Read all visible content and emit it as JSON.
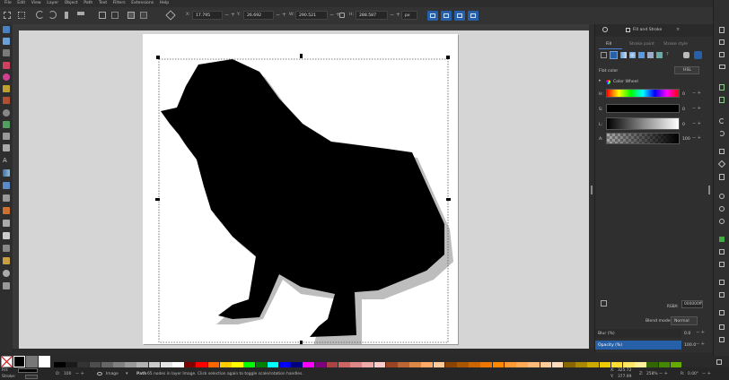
{
  "menu": [
    "File",
    "Edit",
    "View",
    "Layer",
    "Object",
    "Path",
    "Text",
    "Filters",
    "Extensions",
    "Help"
  ],
  "toolbar": {
    "x_label": "X:",
    "x_value": "17.795",
    "y_label": "Y:",
    "y_value": "26.692",
    "w_label": "W:",
    "w_value": "290.521",
    "h_label": "H:",
    "h_value": "288.587",
    "unit": "px"
  },
  "dock": {
    "tab_title": "Fill and Stroke",
    "tabs": [
      "Fill",
      "Stroke paint",
      "Stroke style"
    ],
    "fill_mode": "Flat color",
    "color_model": "HSL",
    "color_wheel_label": "Color Wheel",
    "sliders": [
      {
        "label": "H:",
        "value": "0"
      },
      {
        "label": "S:",
        "value": "0"
      },
      {
        "label": "L:",
        "value": "0"
      },
      {
        "label": "A:",
        "value": "100"
      }
    ],
    "rgba_label": "RGBA:",
    "rgba_value": "000000ff",
    "blend_label": "Blend mode:",
    "blend_value": "Normal",
    "blur_label": "Blur (%)",
    "blur_value": "0.0",
    "opacity_label": "Opacity (%)",
    "opacity_value": "100.0"
  },
  "status": {
    "fill_label": "Fill:",
    "stroke_label": "Stroke:",
    "opacity_label": "O:",
    "opacity_value": "100",
    "layer_name": "Image",
    "message_strong": "Path",
    "message": "65 nodes in layer Image. Click selection again to toggle scale/rotation handles.",
    "x_label": "X:",
    "x_value": "325.72",
    "y_label": "Y:",
    "y_value": "377.99",
    "zoom_label": "Z:",
    "zoom_value": "258%",
    "rot_label": "R:",
    "rot_value": "0.00°"
  },
  "colors": {
    "accent": "#2560a8",
    "palette": [
      "#000000",
      "#1a1a1a",
      "#333333",
      "#4d4d4d",
      "#666666",
      "#808080",
      "#999999",
      "#b3b3b3",
      "#cccccc",
      "#e6e6e6",
      "#ffffff",
      "#800000",
      "#ff0000",
      "#ff6600",
      "#ffcc00",
      "#ffff00",
      "#00ff00",
      "#008000",
      "#00ffff",
      "#0000ff",
      "#000080",
      "#ff00ff",
      "#800080",
      "#aa4444",
      "#cc6666",
      "#dd8888",
      "#eeaaaa",
      "#ffcccc",
      "#994422",
      "#bb6633",
      "#dd8844",
      "#ffaa66",
      "#ffcc99",
      "#884400",
      "#aa5500",
      "#cc6600",
      "#ee7700",
      "#ff8800",
      "#ff9933",
      "#ffaa55",
      "#ffbb77",
      "#ffcc99",
      "#ffddbb",
      "#886600",
      "#aa8800",
      "#ccaa00",
      "#eecc00",
      "#ffdd33",
      "#ffe666",
      "#fff099",
      "#336600",
      "#448800",
      "#66aa00"
    ]
  }
}
